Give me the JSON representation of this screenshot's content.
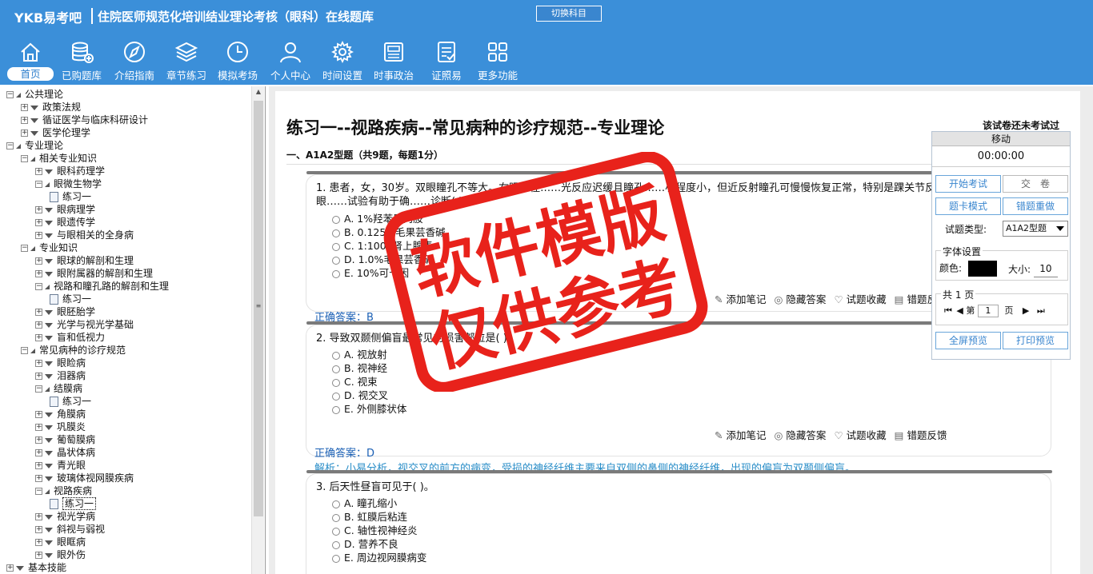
{
  "header": {
    "logo": "YKB易考吧",
    "title": "住院医师规范化培训结业理论考核（眼科）在线题库",
    "switch_label": "切换科目"
  },
  "nav": [
    {
      "label": "首页",
      "icon": "home-icon"
    },
    {
      "label": "已购题库",
      "icon": "database-icon"
    },
    {
      "label": "介绍指南",
      "icon": "compass-icon"
    },
    {
      "label": "章节练习",
      "icon": "layers-icon"
    },
    {
      "label": "模拟考场",
      "icon": "clock-icon"
    },
    {
      "label": "个人中心",
      "icon": "user-icon"
    },
    {
      "label": "时间设置",
      "icon": "gear-icon"
    },
    {
      "label": "时事政治",
      "icon": "news-icon"
    },
    {
      "label": "证照易",
      "icon": "checklist-icon"
    },
    {
      "label": "更多功能",
      "icon": "grid-icon"
    }
  ],
  "tree": [
    {
      "label": "公共理论",
      "level": 0,
      "exp": "-"
    },
    {
      "label": "政策法规",
      "level": 1,
      "exp": "+"
    },
    {
      "label": "循证医学与临床科研设计",
      "level": 1,
      "exp": "+"
    },
    {
      "label": "医学伦理学",
      "level": 1,
      "exp": "+"
    },
    {
      "label": "专业理论",
      "level": 0,
      "exp": "-"
    },
    {
      "label": "相关专业知识",
      "level": 1,
      "exp": "-"
    },
    {
      "label": "眼科药理学",
      "level": 2,
      "exp": "+"
    },
    {
      "label": "眼微生物学",
      "level": 2,
      "exp": "-"
    },
    {
      "label": "练习一",
      "level": 3,
      "exp": "doc"
    },
    {
      "label": "眼病理学",
      "level": 2,
      "exp": "+"
    },
    {
      "label": "眼遗传学",
      "level": 2,
      "exp": "+"
    },
    {
      "label": "与眼相关的全身病",
      "level": 2,
      "exp": "+"
    },
    {
      "label": "专业知识",
      "level": 1,
      "exp": "-"
    },
    {
      "label": "眼球的解剖和生理",
      "level": 2,
      "exp": "+"
    },
    {
      "label": "眼附属器的解剖和生理",
      "level": 2,
      "exp": "+"
    },
    {
      "label": "视路和瞳孔路的解剖和生理",
      "level": 2,
      "exp": "-"
    },
    {
      "label": "练习一",
      "level": 3,
      "exp": "doc"
    },
    {
      "label": "眼胚胎学",
      "level": 2,
      "exp": "+"
    },
    {
      "label": "光学与视光学基础",
      "level": 2,
      "exp": "+"
    },
    {
      "label": "盲和低视力",
      "level": 2,
      "exp": "+"
    },
    {
      "label": "常见病种的诊疗规范",
      "level": 1,
      "exp": "-"
    },
    {
      "label": "眼睑病",
      "level": 2,
      "exp": "+"
    },
    {
      "label": "泪器病",
      "level": 2,
      "exp": "+"
    },
    {
      "label": "结膜病",
      "level": 2,
      "exp": "-"
    },
    {
      "label": "练习一",
      "level": 3,
      "exp": "doc"
    },
    {
      "label": "角膜病",
      "level": 2,
      "exp": "+"
    },
    {
      "label": "巩膜炎",
      "level": 2,
      "exp": "+"
    },
    {
      "label": "葡萄膜病",
      "level": 2,
      "exp": "+"
    },
    {
      "label": "晶状体病",
      "level": 2,
      "exp": "+"
    },
    {
      "label": "青光眼",
      "level": 2,
      "exp": "+"
    },
    {
      "label": "玻璃体视网膜疾病",
      "level": 2,
      "exp": "+"
    },
    {
      "label": "视路疾病",
      "level": 2,
      "exp": "-"
    },
    {
      "label": "练习一",
      "level": 3,
      "exp": "doc",
      "selected": true
    },
    {
      "label": "视光学病",
      "level": 2,
      "exp": "+"
    },
    {
      "label": "斜视与弱视",
      "level": 2,
      "exp": "+"
    },
    {
      "label": "眼眶病",
      "level": 2,
      "exp": "+"
    },
    {
      "label": "眼外伤",
      "level": 2,
      "exp": "+"
    },
    {
      "label": "基本技能",
      "level": 0,
      "exp": "+"
    }
  ],
  "exam": {
    "title": "练习一--视路疾病--常见病种的诊疗规范--专业理论",
    "status": "该试卷还未考试过",
    "section": "一、A1A2型题（共9题，每题1分）"
  },
  "tools": [
    "添加笔记",
    "隐藏答案",
    "试题收藏",
    "错题反馈"
  ],
  "questions": [
    {
      "stem": "1. 患者，女，30岁。双眼瞳孔不等大。右眼直径……光反应迟缓且瞳孔……小程度小，但近反射瞳孔可慢慢恢复正常，特别是踝关节反射减弱。何种眼……试验有助于确……诊断( )。",
      "options": [
        "A. 1%羟苯异丙胺",
        "B. 0.125%毛果芸香碱",
        "C. 1:1000肾上腺素",
        "D. 1.0%毛果芸香碱",
        "E. 10%可卡因"
      ],
      "answer": "正确答案：B",
      "analysis": ""
    },
    {
      "stem": "2. 导致双颞侧偏盲最常见的损害部位是( )。",
      "options": [
        "A. 视放射",
        "B. 视神经",
        "C. 视束",
        "D. 视交叉",
        "E. 外侧膝状体"
      ],
      "answer": "正确答案：D",
      "analysis": "解析：小易分析，视交叉的前方的病变，受损的神经纤维主要来自双侧的鼻侧的神经纤维，出现的偏盲为双颞侧偏盲。"
    },
    {
      "stem": "3. 后天性昼盲可见于( )。",
      "options": [
        "A. 瞳孔缩小",
        "B. 虹膜后粘连",
        "C. 轴性视神经炎",
        "D. 营养不良",
        "E. 周边视网膜病变"
      ],
      "answer": "",
      "analysis": ""
    }
  ],
  "panel": {
    "head": "移动",
    "timer": "00:00:00",
    "start": "开始考试",
    "submit": "交　卷",
    "card_mode": "题卡模式",
    "redo": "错题重做",
    "type_label": "试题类型:",
    "type_value": "A1A2型题",
    "font_legend": "字体设置",
    "color_label": "颜色:",
    "size_label": "大小:",
    "size_value": "10",
    "pages_legend": "共 1 页",
    "page_prefix": "第",
    "page_value": "1",
    "page_suffix": "页",
    "fullscreen": "全屏预览",
    "print": "打印预览"
  },
  "watermark": {
    "line1": "软件模版",
    "line2": "仅供参考",
    "color": "#e8221b"
  }
}
